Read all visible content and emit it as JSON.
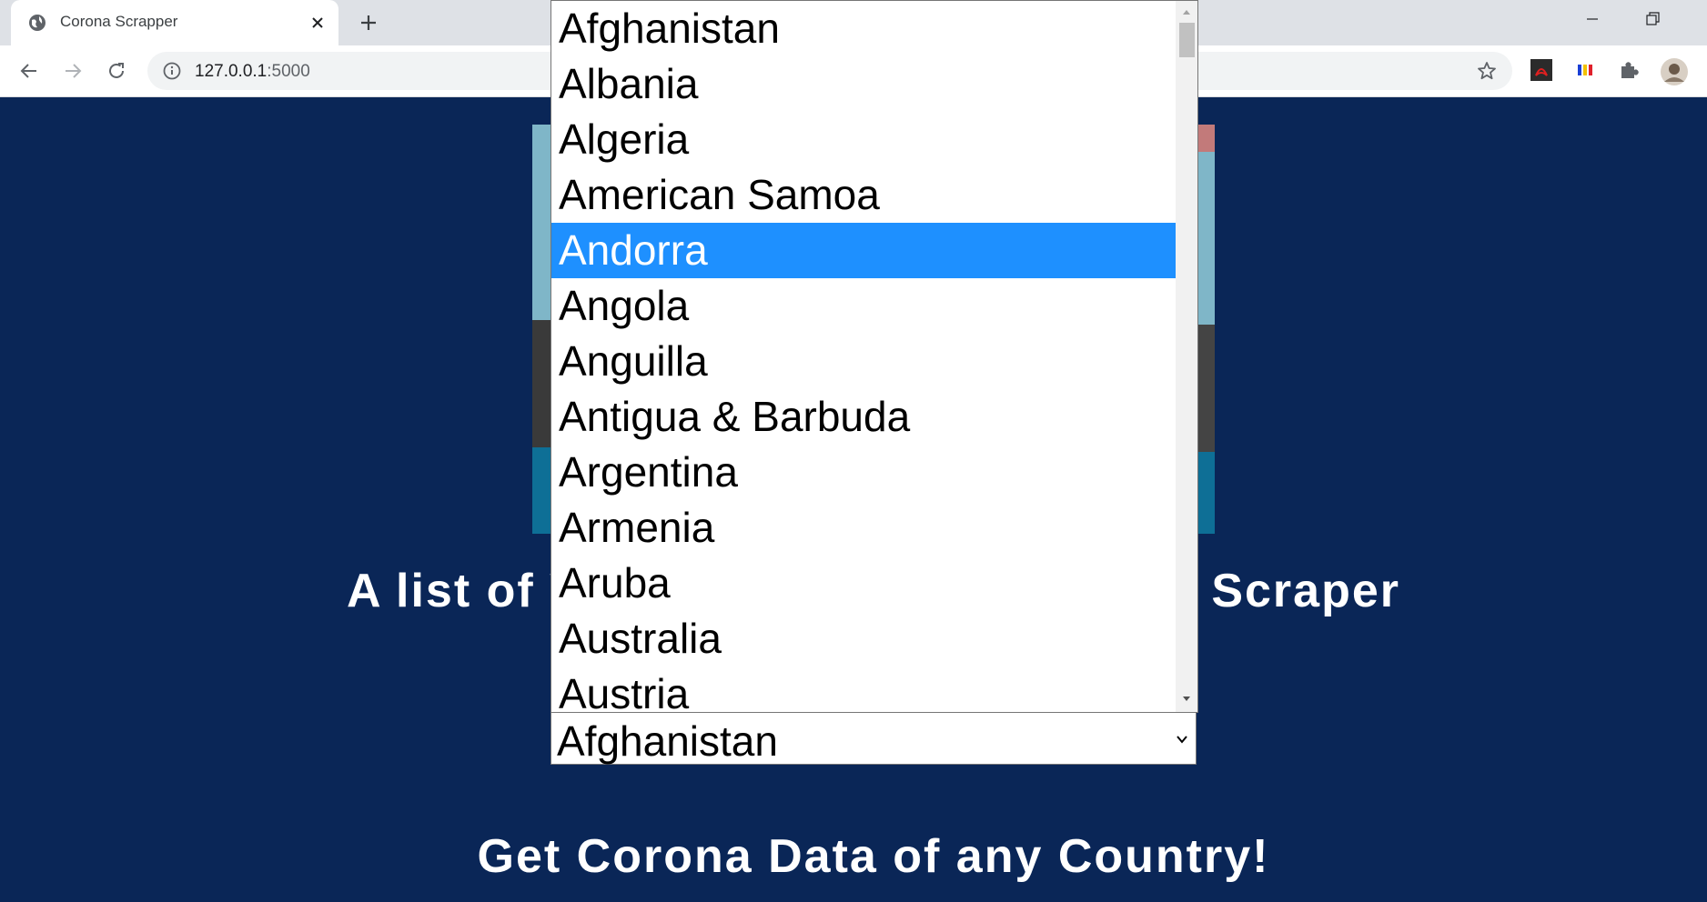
{
  "browser": {
    "tab_title": "Corona Scrapper",
    "url_host": "127.0.0.1",
    "url_port": ":5000"
  },
  "page": {
    "heading_valid": "A list of Valid Countries for Corona Scraper",
    "heading_get": "Get Corona Data of any Country!"
  },
  "select": {
    "value": "Afghanistan",
    "options": [
      "Afghanistan",
      "Albania",
      "Algeria",
      "American Samoa",
      "Andorra",
      "Angola",
      "Anguilla",
      "Antigua & Barbuda",
      "Argentina",
      "Armenia",
      "Aruba",
      "Australia",
      "Austria"
    ],
    "highlighted": "Andorra"
  },
  "colors": {
    "page_bg": "#0a2657",
    "highlight": "#1e90ff"
  }
}
